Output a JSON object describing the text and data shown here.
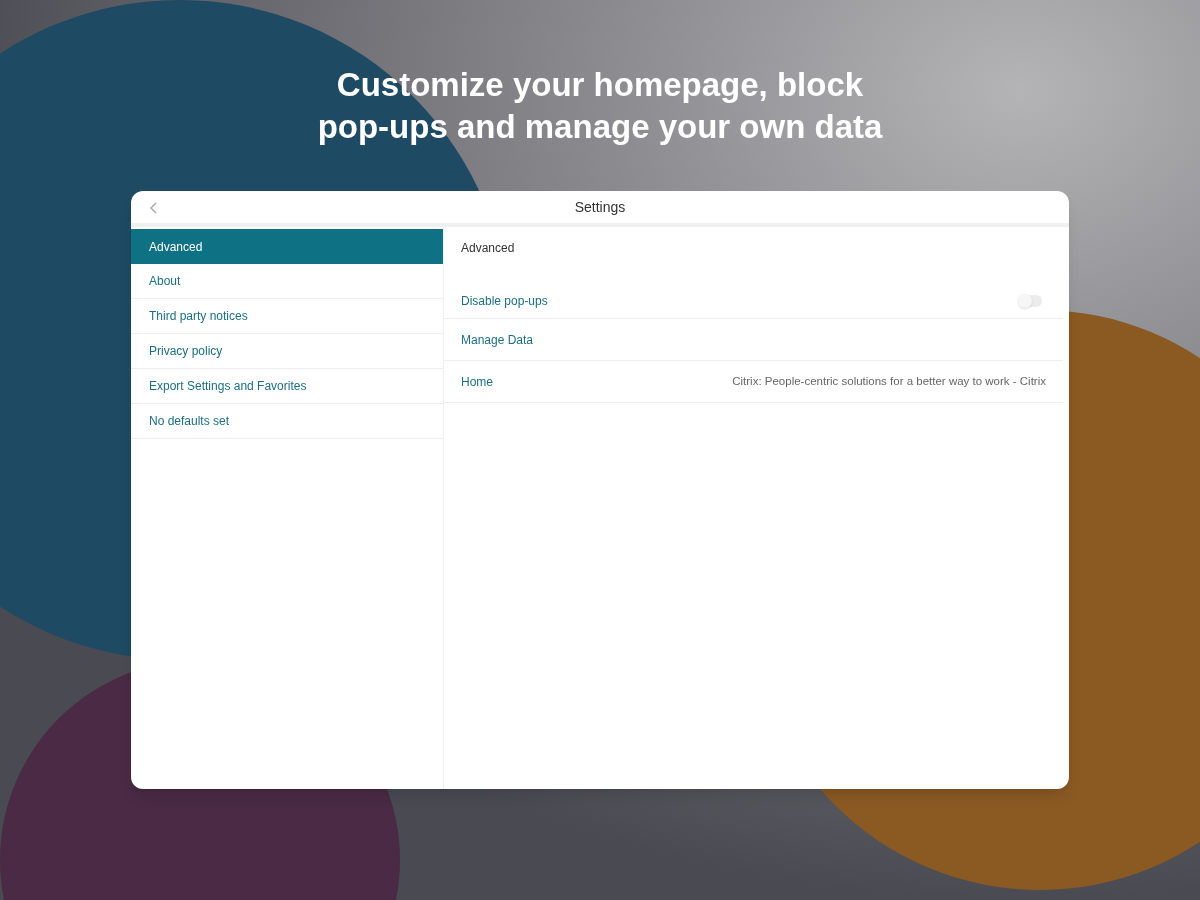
{
  "headline": "Customize your homepage, block pop-ups and manage your own data",
  "window": {
    "title": "Settings"
  },
  "sidebar": {
    "items": [
      {
        "label": "Advanced",
        "selected": true
      },
      {
        "label": "About",
        "selected": false
      },
      {
        "label": "Third party notices",
        "selected": false
      },
      {
        "label": "Privacy policy",
        "selected": false
      },
      {
        "label": "Export Settings and Favorites",
        "selected": false
      },
      {
        "label": "No defaults set",
        "selected": false
      }
    ]
  },
  "detail": {
    "section_title": "Advanced",
    "rows": [
      {
        "kind": "toggle",
        "label": "Disable pop-ups",
        "on": false
      },
      {
        "kind": "link",
        "label": "Manage Data"
      },
      {
        "kind": "value",
        "label": "Home",
        "value": "Citrix: People-centric solutions for a better way to work - Citrix"
      }
    ]
  }
}
